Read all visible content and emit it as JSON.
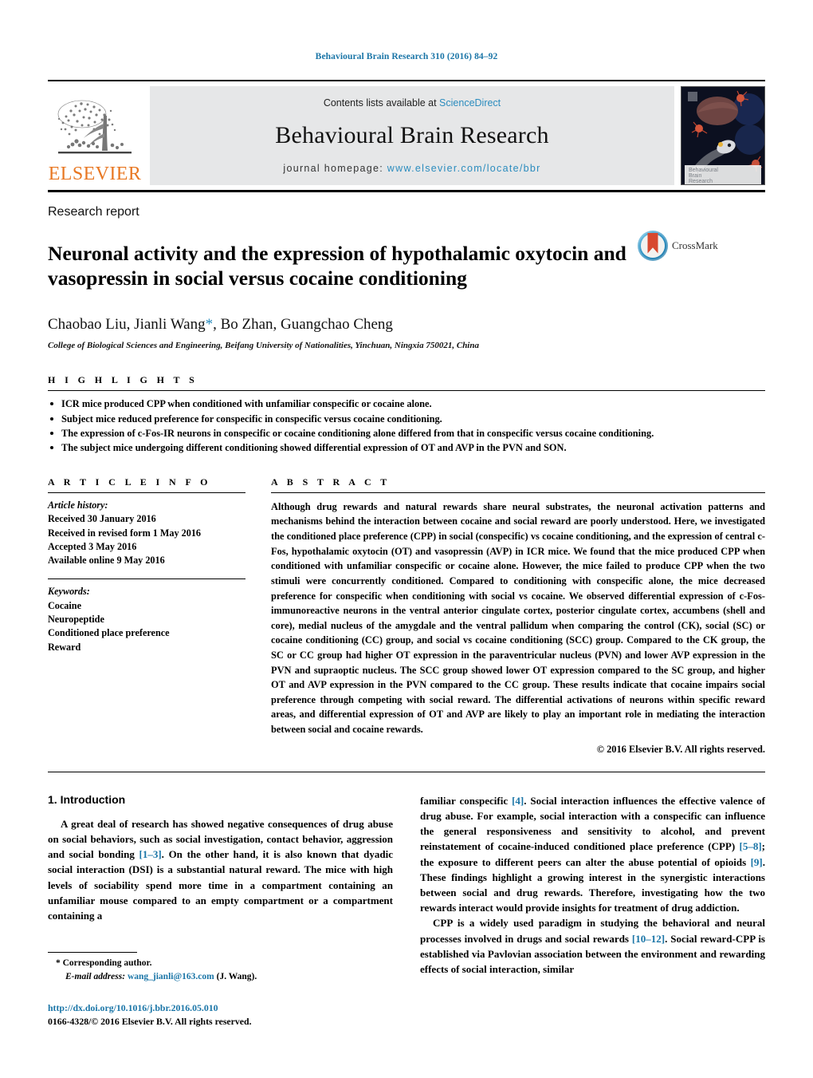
{
  "running_head": "Behavioural Brain Research 310 (2016) 84–92",
  "masthead": {
    "publisher_name": "ELSEVIER",
    "contents_prefix": "Contents lists available at ",
    "sciencedirect": "ScienceDirect",
    "journal_title": "Behavioural Brain Research",
    "homepage_prefix": "journal homepage: ",
    "homepage_url": "www.elsevier.com/locate/bbr",
    "cover_caption_line1": "Behavioural",
    "cover_caption_line2": "Brain",
    "cover_caption_line3": "Research",
    "accent_blue": "#2b8cbe",
    "elsevier_orange": "#E87722",
    "panel_gray": "#e6e7e8"
  },
  "article": {
    "type": "Research report",
    "title": "Neuronal activity and the expression of hypothalamic oxytocin and vasopressin in social versus cocaine conditioning",
    "authors_plain": "Chaobao Liu, Jianli Wang",
    "authors_rest": ", Bo Zhan, Guangchao Cheng",
    "corresponding_marker": "*",
    "affiliation": "College of Biological Sciences and Engineering, Beifang University of Nationalities, Yinchuan, Ningxia 750021, China",
    "crossmark_label": "CrossMark"
  },
  "highlights": {
    "heading": "H I G H L I G H T S",
    "items": [
      "ICR mice produced CPP when conditioned with unfamiliar conspecific or cocaine alone.",
      "Subject mice reduced preference for conspecific in conspecific versus cocaine conditioning.",
      "The expression of c-Fos-IR neurons in conspecific or cocaine conditioning alone differed from that in conspecific versus cocaine conditioning.",
      "The subject mice undergoing different conditioning showed differential expression of OT and AVP in the PVN and SON."
    ]
  },
  "article_info": {
    "heading": "A R T I C L E    I N F O",
    "history_label": "Article history:",
    "history": [
      "Received 30 January 2016",
      "Received in revised form 1 May 2016",
      "Accepted 3 May 2016",
      "Available online 9 May 2016"
    ],
    "keywords_label": "Keywords:",
    "keywords": [
      "Cocaine",
      "Neuropeptide",
      "Conditioned place preference",
      "Reward"
    ]
  },
  "abstract": {
    "heading": "A B S T R A C T",
    "text": "Although drug rewards and natural rewards share neural substrates, the neuronal activation patterns and mechanisms behind the interaction between cocaine and social reward are poorly understood. Here, we investigated the conditioned place preference (CPP) in social (conspecific) vs cocaine conditioning, and the expression of central c-Fos, hypothalamic oxytocin (OT) and vasopressin (AVP) in ICR mice. We found that the mice produced CPP when conditioned with unfamiliar conspecific or cocaine alone. However, the mice failed to produce CPP when the two stimuli were concurrently conditioned. Compared to conditioning with conspecific alone, the mice decreased preference for conspecific when conditioning with social vs cocaine. We observed differential expression of c-Fos-immunoreactive neurons in the ventral anterior cingulate cortex, posterior cingulate cortex, accumbens (shell and core), medial nucleus of the amygdale and the ventral pallidum when comparing the control (CK), social (SC) or cocaine conditioning (CC) group, and social vs cocaine conditioning (SCC) group. Compared to the CK group, the SC or CC group had higher OT expression in the paraventricular nucleus (PVN) and lower AVP expression in the PVN and supraoptic nucleus. The SCC group showed lower OT expression compared to the SC group, and higher OT and AVP expression in the PVN compared to the CC group. These results indicate that cocaine impairs social preference through competing with social reward. The differential activations of neurons within specific reward areas, and differential expression of OT and AVP are likely to play an important role in mediating the interaction between social and cocaine rewards.",
    "copyright": "© 2016 Elsevier B.V. All rights reserved."
  },
  "introduction": {
    "section_number_title": "1.  Introduction",
    "left_para_1_a": "A great deal of research has showed negative consequences of drug abuse on social behaviors, such as social investigation, contact behavior, aggression and social bonding ",
    "left_ref_1": "[1–3]",
    "left_para_1_b": ". On the other hand, it is also known that dyadic social interaction (DSI) is a substantial natural reward. The mice with high levels of sociability spend more time in a compartment containing an unfamiliar mouse compared to an empty compartment or a compartment containing a",
    "right_para_1_a": "familiar conspecific ",
    "right_ref_1": "[4]",
    "right_para_1_b": ". Social interaction influences the effective valence of drug abuse. For example, social interaction with a conspecific can influence the general responsiveness and sensitivity to alcohol, and prevent reinstatement of cocaine-induced conditioned place preference (CPP) ",
    "right_ref_2": "[5–8]",
    "right_para_1_c": "; the exposure to different peers can alter the abuse potential of opioids ",
    "right_ref_3": "[9]",
    "right_para_1_d": ". These findings highlight a growing interest in the synergistic interactions between social and drug rewards. Therefore, investigating how the two rewards interact would provide insights for treatment of drug addiction.",
    "right_para_2_a": "CPP is a widely used paradigm in studying the behavioral and neural processes involved in drugs and social rewards ",
    "right_ref_4": "[10–12]",
    "right_para_2_b": ". Social reward-CPP is established via Pavlovian association between the environment and rewarding effects of social interaction, similar"
  },
  "footer": {
    "corresponding_marker": "*",
    "corresponding_label": "Corresponding author.",
    "email_label": "E-mail address:",
    "email": "wang_jianli@163.com",
    "email_suffix": "(J. Wang).",
    "doi": "http://dx.doi.org/10.1016/j.bbr.2016.05.010",
    "issn_line": "0166-4328/© 2016 Elsevier B.V. All rights reserved."
  }
}
